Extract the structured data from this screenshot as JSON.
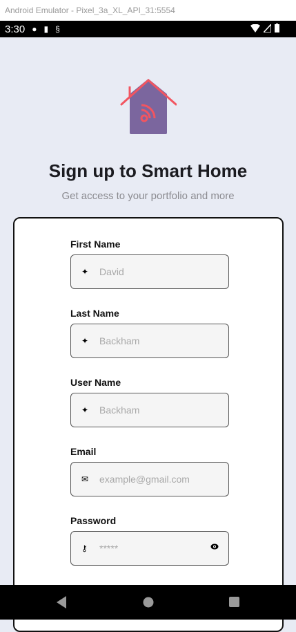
{
  "window": {
    "title": "Android Emulator - Pixel_3a_XL_API_31:5554"
  },
  "status_bar": {
    "time": "3:30",
    "icons": [
      "app-icon",
      "sd-card-icon",
      "sim-icon",
      "wifi-icon",
      "signal-icon",
      "battery-icon"
    ]
  },
  "header": {
    "title": "Sign up to Smart Home",
    "subtitle": "Get access to your portfolio and more"
  },
  "colors": {
    "house": "#7b669e",
    "roof": "#f25560",
    "background": "#e8ebf4"
  },
  "form": {
    "fields": [
      {
        "label": "First Name",
        "placeholder": "David",
        "icon": "pin-icon"
      },
      {
        "label": "Last Name",
        "placeholder": "Backham",
        "icon": "pin-icon"
      },
      {
        "label": "User Name",
        "placeholder": "Backham",
        "icon": "pin-icon"
      },
      {
        "label": "Email",
        "placeholder": "example@gmail.com",
        "icon": "mail-icon"
      },
      {
        "label": "Password",
        "placeholder": "*****",
        "icon": "key-icon"
      }
    ]
  }
}
